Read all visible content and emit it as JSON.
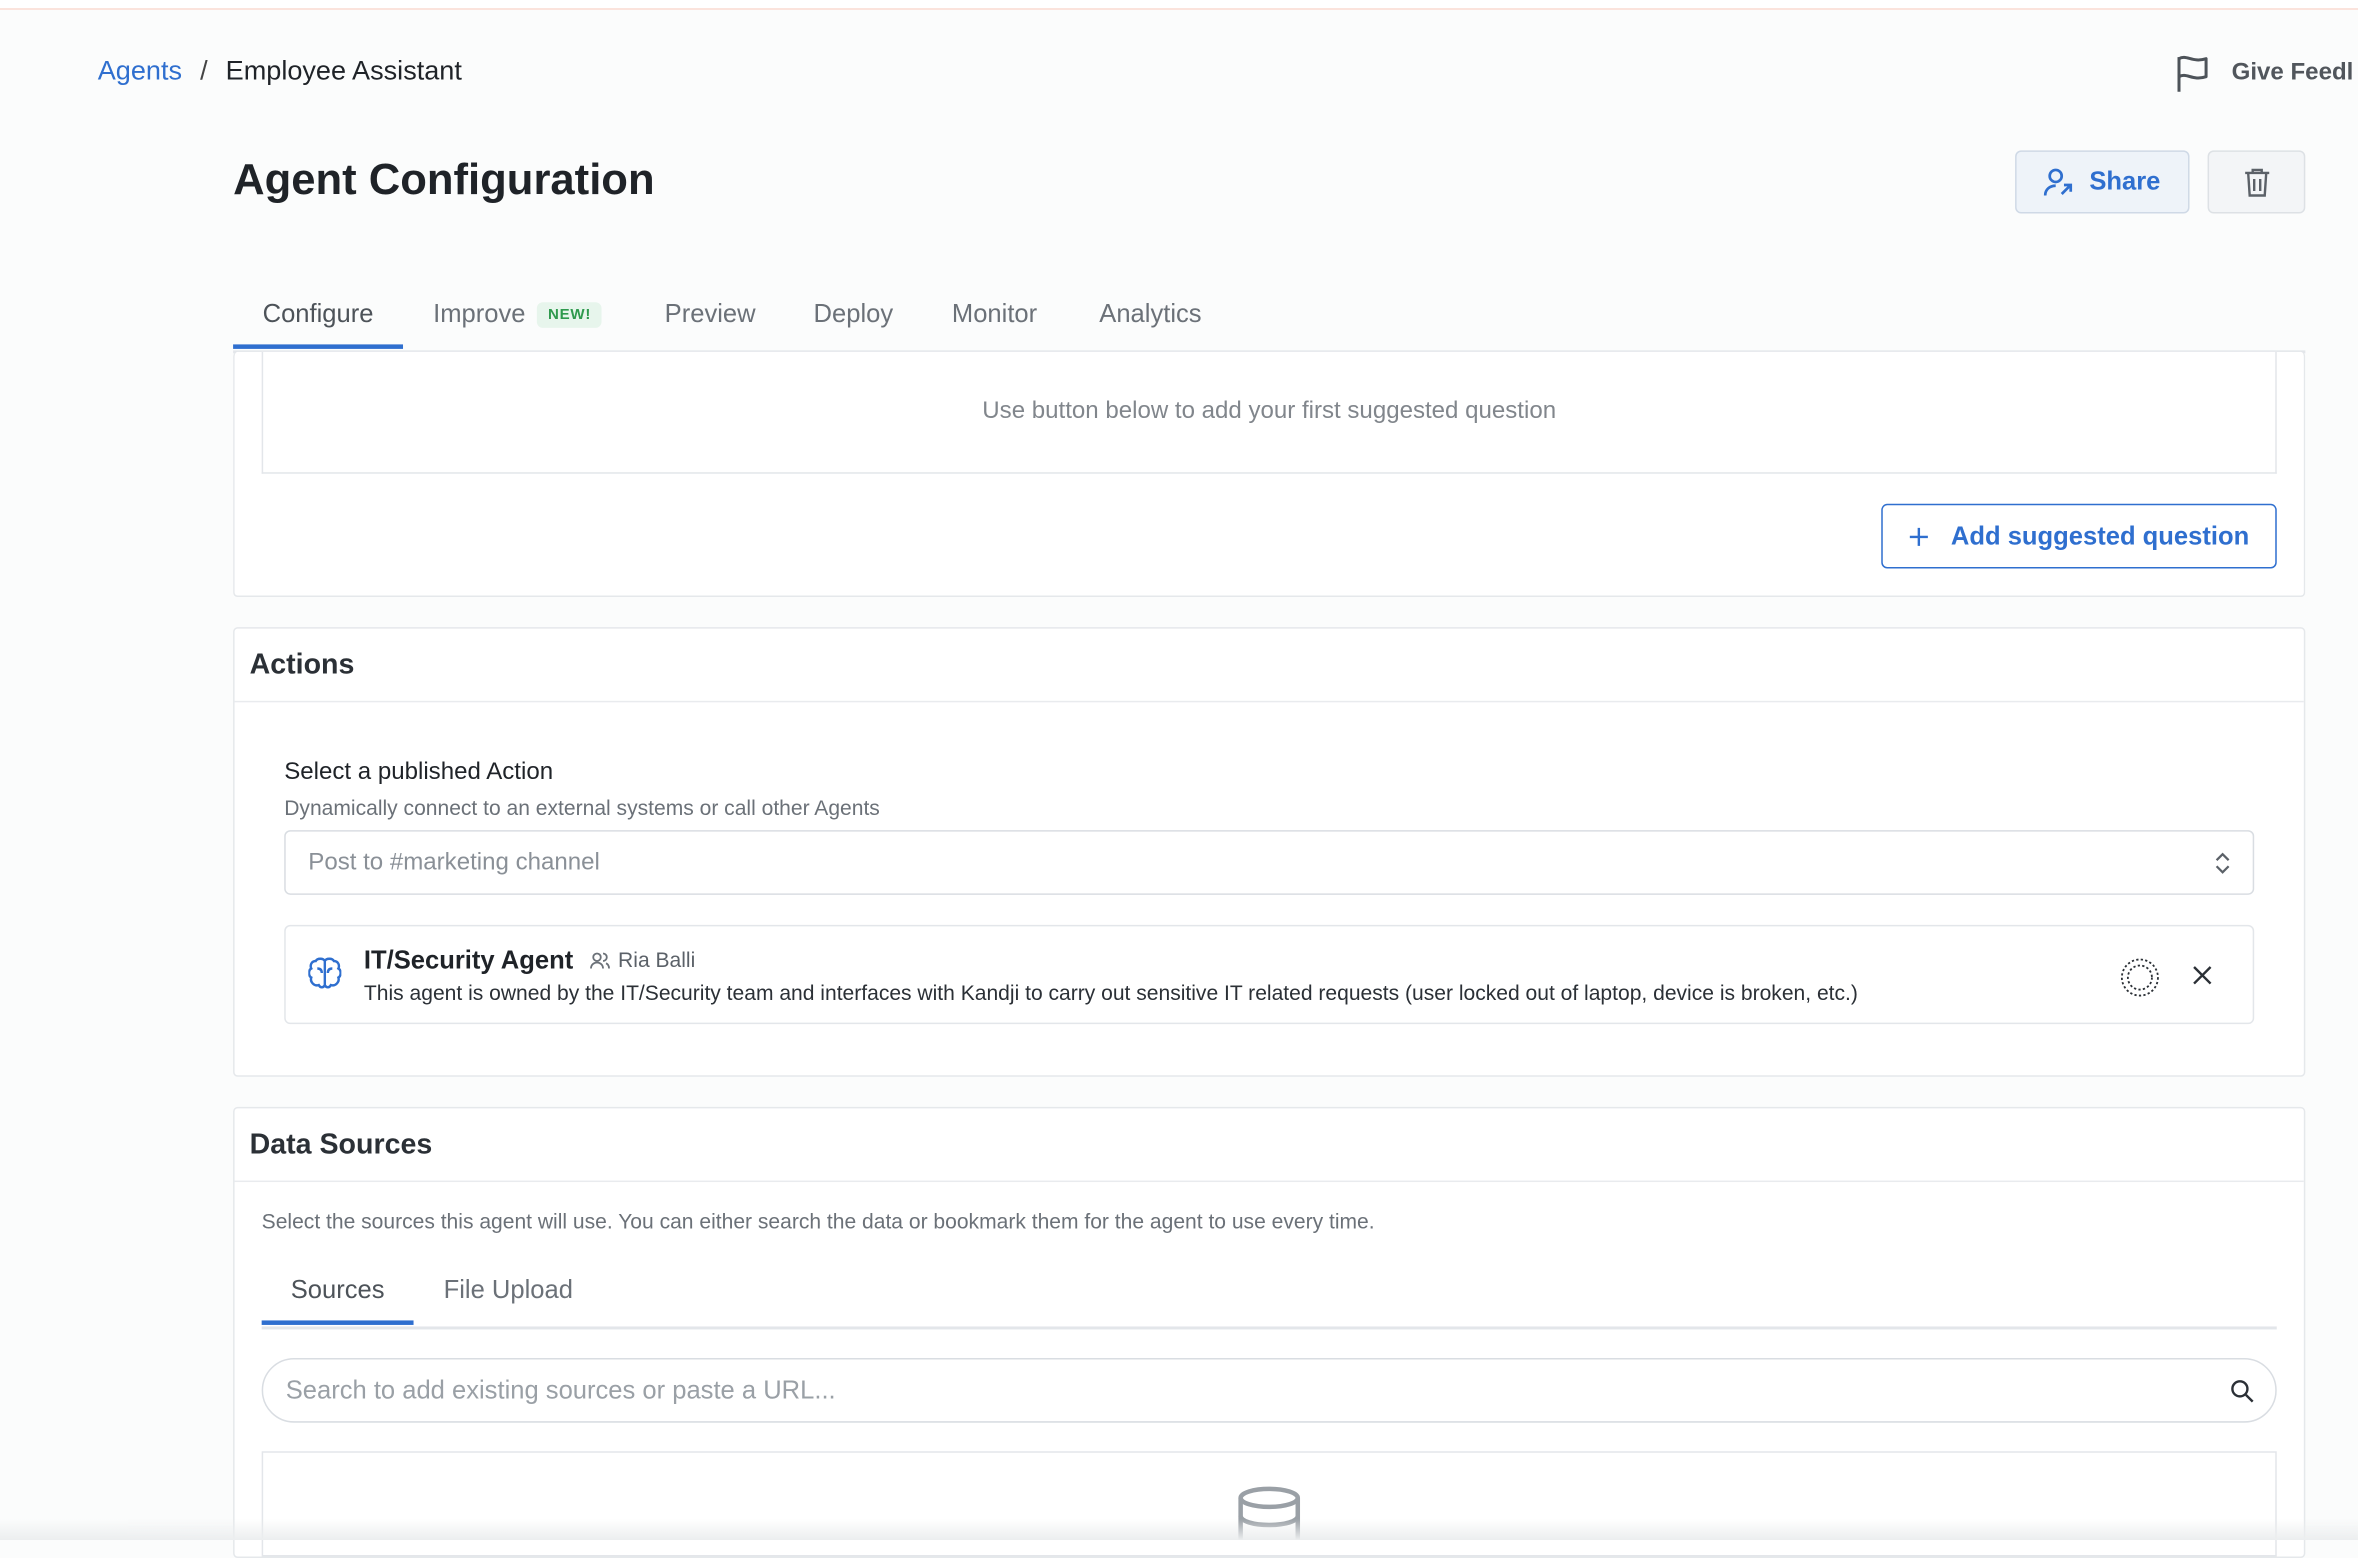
{
  "breadcrumb": {
    "parent": "Agents",
    "separator": "/",
    "current": "Employee Assistant"
  },
  "header": {
    "feedback_label": "Give Feedl",
    "title": "Agent Configuration",
    "share_label": "Share"
  },
  "tabs": [
    {
      "label": "Configure",
      "active": true
    },
    {
      "label": "Improve",
      "badge": "NEW!"
    },
    {
      "label": "Preview"
    },
    {
      "label": "Deploy"
    },
    {
      "label": "Monitor"
    },
    {
      "label": "Analytics"
    }
  ],
  "suggested": {
    "empty_text": "Use button below to add your first suggested question",
    "add_label": "Add suggested question"
  },
  "actions": {
    "title": "Actions",
    "select_label": "Select a published Action",
    "select_hint": "Dynamically connect to an external systems or call other Agents",
    "select_placeholder": "Post to #marketing channel",
    "item": {
      "name": "IT/Security Agent",
      "owner": "Ria Balli",
      "description": "This agent is owned by the IT/Security team and interfaces with Kandji to carry out sensitive IT related requests (user locked out of laptop, device is broken, etc.)"
    }
  },
  "data_sources": {
    "title": "Data Sources",
    "hint": "Select the sources this agent will use. You can either search the data or bookmark them for the agent to use every time.",
    "tabs": [
      {
        "label": "Sources",
        "active": true
      },
      {
        "label": "File Upload"
      }
    ],
    "search_placeholder": "Search to add existing sources or paste a URL..."
  },
  "colors": {
    "accent": "#2f6fcf",
    "badge_green": "#2f9a4e"
  }
}
